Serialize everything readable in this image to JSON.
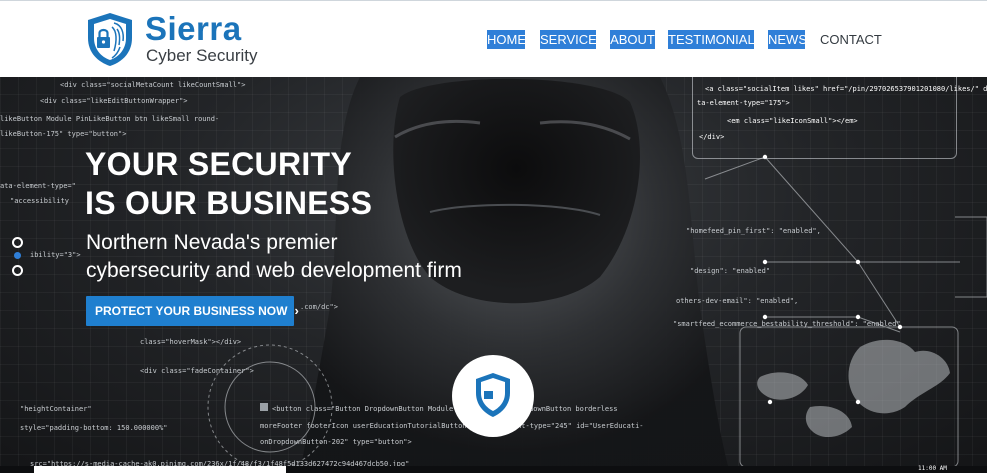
{
  "brand": {
    "name": "Sierra",
    "subtitle": "Cyber Security",
    "color": "#1b74ba"
  },
  "nav": {
    "items": [
      {
        "label": "HOME",
        "selected": true
      },
      {
        "label": "SERVICES",
        "selected": true
      },
      {
        "label": "ABOUT",
        "selected": true
      },
      {
        "label": "TESTIMONIALS",
        "selected": true
      },
      {
        "label": "NEWS",
        "selected": true
      },
      {
        "label": "CONTACT",
        "selected": false
      }
    ],
    "highlight_color": "#2f7fd8"
  },
  "hero": {
    "headline_line1": "YOUR SECURITY",
    "headline_line2": "IS OUR BUSINESS",
    "tagline_line1": "Northern Nevada's premier",
    "tagline_line2": "cybersecurity and web development firm",
    "cta_label": "PROTECT YOUR BUSINESS NOW",
    "cta_icon": "chevron-right-icon",
    "cta_color": "#1f7fcf",
    "slider_dots": 2,
    "active_dot": 1
  },
  "code_box": {
    "lines": [
      "<a class=\"socialItem likes\" href=\"/pin/297026537901201080/likes/\" da-",
      "ta-element-type=\"175\">",
      "<em class=\"likeIconSmall\"></em>",
      "</div>"
    ]
  },
  "background_code": [
    "<div class=\"socialMetaCount likeCountSmall\">",
    "<div class=\"likeEditButtonWrapper\">",
    "likeButton Module PinLikeButton btn likeSmall round-",
    "likeButton-175\" type=\"button\">",
    "ata-element-type=\"",
    "\"accessibility",
    "ibility=\"3\">",
    "class=\"hoverMask\"></div>",
    "<div class=\"fadeContainer\">",
    "\"heightContainer\"",
    "style=\"padding-bottom: 150.000000%\"",
    "src=\"https://s-media-cache-ak0.pinimg.com/236x/1f/48/f3/1f48f5d133d627472c94d467dcb50.jpg\"",
    "<button class=\"Button DropdownButton Module UserEducationDropdownButton borderless",
    "moreFooter footerIcon userEducationTutorialButton\" data-element-type=\"245\" id=\"UserEducati-",
    "onDropdownButton-202\" type=\"button\">",
    ".com/dc\">",
    "others-dev-email\": \"enabled\",",
    "\"smartfeed_ecommerce_bestability_threshold\": \"enabled\"",
    "\"homefeed_pin_first\": \"enabled\",",
    "\"design\": \"enabled\""
  ],
  "status_time": "11:00 AM"
}
